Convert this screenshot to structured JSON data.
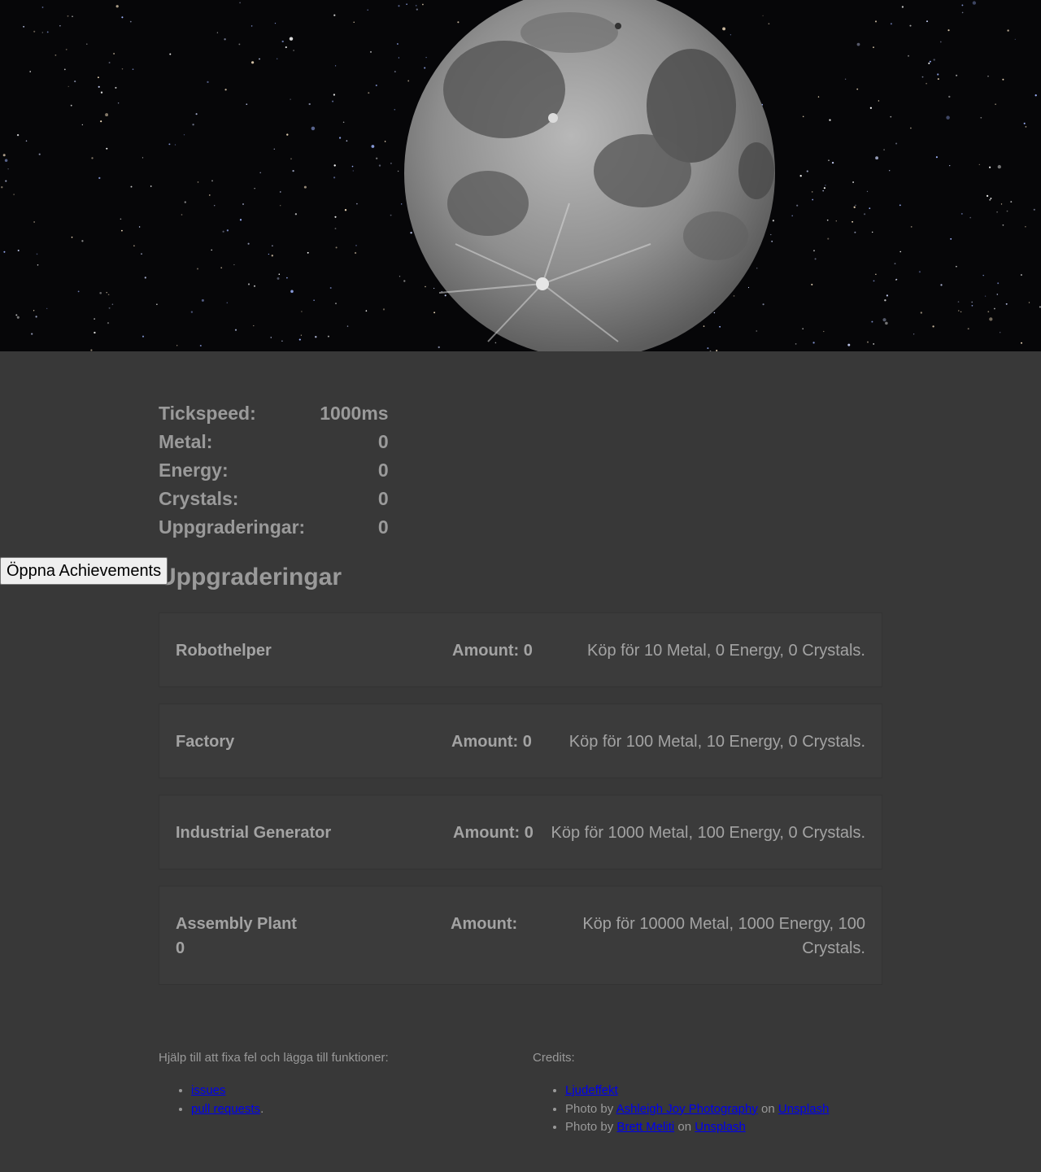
{
  "stats": [
    {
      "label": "Tickspeed:",
      "value": "1000ms"
    },
    {
      "label": "Metal:",
      "value": "0"
    },
    {
      "label": "Energy:",
      "value": "0"
    },
    {
      "label": "Crystals:",
      "value": "0"
    },
    {
      "label": "Uppgraderingar:",
      "value": "0"
    }
  ],
  "achievements_button": "Öppna Achievements",
  "upgrades_heading": "Uppgraderingar",
  "upgrades": [
    {
      "name": "Robothelper",
      "amount": "Amount: 0",
      "cost": "Köp för 10 Metal, 0 Energy, 0 Crystals."
    },
    {
      "name": "Factory",
      "amount": "Amount: 0",
      "cost": "Köp för 100 Metal, 10 Energy, 0 Crystals."
    },
    {
      "name": "Industrial Generator",
      "amount": "Amount: 0",
      "cost": "Köp för 1000 Metal, 100 Energy, 0 Crystals."
    },
    {
      "name": "Assembly Plant",
      "name_line2": "0",
      "amount": "Amount:",
      "cost": "Köp för 10000 Metal, 1000 Energy, 100",
      "cost_line2": "Crystals."
    }
  ],
  "footer": {
    "help_text": "Hjälp till att fixa fel och lägga till funktioner:",
    "help_links": [
      "issues",
      "pull requests"
    ],
    "help_period": ".",
    "credits_title": "Credits:",
    "credit_sound": "Ljudeffekt",
    "photo_prefix": "Photo by",
    "on_word": "on",
    "credit1_author": "Ashleigh Joy Photography",
    "credit1_site": "Unsplash",
    "credit2_author": "Brett Meliti",
    "credit2_site": "Unsplash"
  }
}
